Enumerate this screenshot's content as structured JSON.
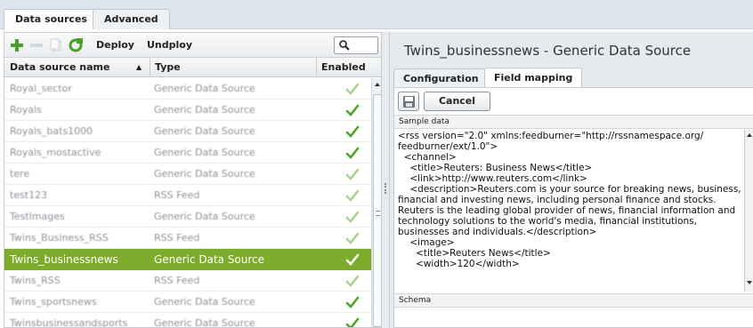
{
  "top_tabs": [
    {
      "label": "Data sources",
      "active": true
    },
    {
      "label": "Advanced",
      "active": false
    }
  ],
  "toolbar": {
    "add_icon": "plus-icon",
    "remove_icon": "minus-icon",
    "copy_icon": "copy-icon",
    "refresh_icon": "refresh-icon",
    "deploy_label": "Deploy",
    "undeploy_label": "Undploy",
    "search_icon": "search-icon"
  },
  "table": {
    "columns": [
      "Data source name",
      "Type",
      "Enabled"
    ],
    "sort_indicator": "▲",
    "rows": [
      {
        "name": "Royal_sector",
        "type": "Generic Data Source",
        "enabled": false
      },
      {
        "name": "Royals",
        "type": "Generic Data Source",
        "enabled": true
      },
      {
        "name": "Royals_bats1000",
        "type": "Generic Data Source",
        "enabled": true
      },
      {
        "name": "Royals_mostactive",
        "type": "Generic Data Source",
        "enabled": true
      },
      {
        "name": "tere",
        "type": "Generic Data Source",
        "enabled": false
      },
      {
        "name": "test123",
        "type": "RSS Feed",
        "enabled": false
      },
      {
        "name": "TestImages",
        "type": "Generic Data Source",
        "enabled": false
      },
      {
        "name": "Twins_Business_RSS",
        "type": "RSS Feed",
        "enabled": false
      },
      {
        "name": "Twins_businessnews",
        "type": "Generic Data Source",
        "enabled": false,
        "selected": true
      },
      {
        "name": "Twins_RSS",
        "type": "RSS Feed",
        "enabled": false
      },
      {
        "name": "Twins_sportsnews",
        "type": "Generic Data Source",
        "enabled": true
      },
      {
        "name": "Twinsbusinessandsports",
        "type": "Generic Data Source",
        "enabled": true
      }
    ]
  },
  "detail": {
    "title": "Twins_businessnews - Generic Data Source",
    "tabs": [
      {
        "label": "Configuration",
        "active": false
      },
      {
        "label": "Field mapping",
        "active": true
      }
    ],
    "save_icon": "floppy-disk-icon",
    "cancel_label": "Cancel",
    "sample_label": "Sample data",
    "schema_label": "Schema",
    "sample_text": "<rss version=\"2.0\" xmlns:feedburner=\"http://rssnamespace.org/\nfeedburner/ext/1.0\">\n  <channel>\n    <title>Reuters: Business News</title>\n    <link>http://www.reuters.com</link>\n    <description>Reuters.com is your source for breaking news, business,\nfinancial and investing news, including personal finance and stocks.\nReuters is the leading global provider of news, financial information and\ntechnology solutions to the world's media, financial institutions,\nbusinesses and individuals.</description>\n    <image>\n      <title>Reuters News</title>\n      <width>120</width>"
  },
  "colors": {
    "selected_row": "#7dab2c",
    "check_enabled": "#4fa52a",
    "check_disabled": "#a9d38e"
  }
}
